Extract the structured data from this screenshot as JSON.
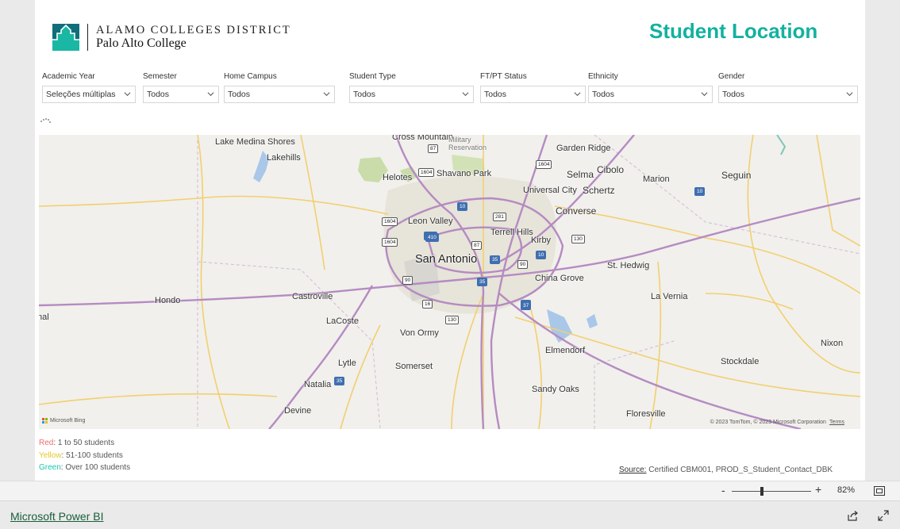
{
  "header": {
    "logo_line1": "ALAMO COLLEGES DISTRICT",
    "logo_line2": "Palo Alto College",
    "title": "Student Location",
    "title_color": "#13b1a0"
  },
  "filters": [
    {
      "label": "Academic Year",
      "value": "Seleções múltiplas"
    },
    {
      "label": "Semester",
      "value": "Todos"
    },
    {
      "label": "Home Campus",
      "value": "Todos"
    },
    {
      "label": "Student Type",
      "value": "Todos"
    },
    {
      "label": "FT/PT Status",
      "value": "Todos"
    },
    {
      "label": "Ethnicity",
      "value": "Todos"
    },
    {
      "label": "Gender",
      "value": "Todos"
    }
  ],
  "map": {
    "places": {
      "cross_mountain": "Cross Mountain",
      "military_reservation": "Military Reservation",
      "garden_ridge": "Garden Ridge",
      "lake_medina_shores": "Lake Medina Shores",
      "lakehills": "Lakehills",
      "helotes": "Helotes",
      "shavano_park": "Shavano Park",
      "selma": "Selma",
      "cibolo": "Cibolo",
      "marion": "Marion",
      "seguin": "Seguin",
      "universal_city": "Universal City",
      "schertz": "Schertz",
      "converse": "Converse",
      "leon_valley": "Leon Valley",
      "terrell_hills": "Terrell Hills",
      "kirby": "Kirby",
      "san_antonio": "San Antonio",
      "st_hedwig": "St. Hedwig",
      "china_grove": "China Grove",
      "hondo": "Hondo",
      "castroville": "Castroville",
      "la_vernia": "La Vernia",
      "lacoste": "LaCoste",
      "von_ormy": "Von Ormy",
      "elmendorf": "Elmendorf",
      "nixon": "Nixon",
      "stockdale": "Stockdale",
      "lytle": "Lytle",
      "somerset": "Somerset",
      "natalia": "Natalia",
      "sandy_oaks": "Sandy Oaks",
      "devine": "Devine",
      "floresville": "Floresville",
      "left_edge": "nal"
    },
    "highway_shields": [
      "87",
      "1604",
      "1604",
      "10",
      "281",
      "410",
      "1604",
      "1604",
      "410",
      "87",
      "35",
      "37",
      "90",
      "10",
      "130",
      "35",
      "90",
      "16",
      "130",
      "37",
      "35",
      "10"
    ],
    "bing_label": "Microsoft Bing",
    "copyright": "© 2023 TomTom, © 2023 Microsoft Corporation",
    "terms": "Terms"
  },
  "legend": {
    "red_label": "Red",
    "red_text": ": 1 to 50 students",
    "yellow_label": "Yellow",
    "yellow_text": ": 51-100 students",
    "green_label": "Green",
    "green_text": ": Over 100 students",
    "colors": {
      "red": "#f06d6d",
      "yellow": "#e6c628",
      "green": "#17c6b0"
    }
  },
  "source": {
    "label": "Source:",
    "text": " Certified CBM001, PROD_S_Student_Contact_DBK"
  },
  "zoom": {
    "minus": "-",
    "plus": "+",
    "level": "82%",
    "value": 0.82
  },
  "footer": {
    "link": "Microsoft Power BI"
  }
}
